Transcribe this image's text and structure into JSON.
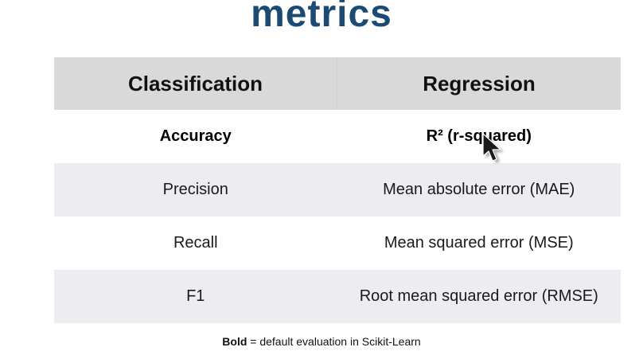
{
  "slide": {
    "title": "metrics"
  },
  "table": {
    "headers": [
      "Classification",
      "Regression"
    ],
    "rows": [
      [
        "Accuracy",
        "R² (r-squared)"
      ],
      [
        "Precision",
        "Mean absolute error (MAE)"
      ],
      [
        "Recall",
        "Mean squared error (MSE)"
      ],
      [
        "F1",
        "Root mean squared error (RMSE)"
      ]
    ]
  },
  "footnote": {
    "bold_word": "Bold",
    "rest": " = default evaluation in Scikit-Learn"
  },
  "colors": {
    "title": "#1b4b72",
    "header_bg": "#d9d9d9",
    "shaded_row_bg": "#ededf1"
  },
  "icons": {
    "cursor": "mouse-pointer-arrow"
  }
}
